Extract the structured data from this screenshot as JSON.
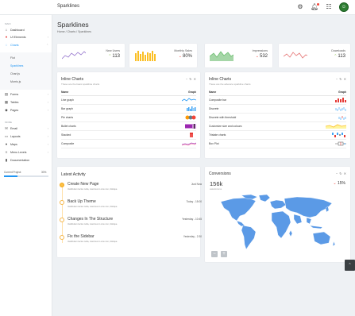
{
  "app": {
    "title": "Sparklines"
  },
  "topbar": {
    "settings_icon": "gear-icon",
    "notifications_icon": "bell-icon",
    "apps_icon": "grid-icon",
    "avatar_icon": "android-icon"
  },
  "sidebar": {
    "section_main": "MAIN",
    "items": [
      {
        "label": "Dashboard",
        "icon": "home-icon"
      },
      {
        "label": "UI Elements",
        "icon": "palette-icon"
      },
      {
        "label": "Charts",
        "icon": "chart-donut-icon"
      }
    ],
    "charts_sub": [
      "Flot",
      "Sparklines",
      "Chart.js",
      "Morris.js"
    ],
    "items2": [
      {
        "label": "Forms",
        "icon": "forms-icon"
      },
      {
        "label": "Tables",
        "icon": "table-icon"
      },
      {
        "label": "Pages",
        "icon": "diamond-icon"
      }
    ],
    "section_more": "MORE",
    "items3": [
      {
        "label": "Email",
        "icon": "email-icon"
      },
      {
        "label": "Layouts",
        "icon": "layouts-icon"
      },
      {
        "label": "Maps",
        "icon": "map-marker-icon"
      },
      {
        "label": "Menu Levels",
        "icon": "menu-icon"
      },
      {
        "label": "Documentation",
        "icon": "book-icon"
      }
    ],
    "project_label": "Current Project",
    "project_pct": "30%",
    "project_value": 30
  },
  "header": {
    "title": "Sparklines",
    "breadcrumb": "Home / Charts / Sparklines"
  },
  "stats": [
    {
      "label": "New Users",
      "value": "113",
      "direction": "up",
      "color": "#9575cd"
    },
    {
      "label": "Monthly Sales",
      "value": "80%",
      "direction": "down",
      "color": "#fbbf24"
    },
    {
      "label": "Impressions",
      "value": "532",
      "direction": "down",
      "color": "#66bb6a"
    },
    {
      "label": "Downloads",
      "value": "113",
      "direction": "up",
      "color": "#e57373"
    }
  ],
  "inline_charts_1": {
    "title": "Inline Charts",
    "subtitle": "These are the basic sparkline charts",
    "col_name": "Name",
    "col_graph": "Graph",
    "rows": [
      "Line graph",
      "Bar graph",
      "Pie charts",
      "Bullet charts",
      "Stacked",
      "Composite"
    ]
  },
  "inline_charts_2": {
    "title": "Inline Charts",
    "subtitle": "These are the advance sparkline charts",
    "col_name": "Name",
    "col_graph": "Graph",
    "rows": [
      "Composite bar",
      "Discrete",
      "Discrete with threshold",
      "Customize size and colours",
      "Tristate charts",
      "Box Plot"
    ]
  },
  "activity": {
    "title": "Latest Activity",
    "items": [
      {
        "title": "Create New Page",
        "desc": "Vestibulum lectus nulla, maximus in eros non, tristique.",
        "time": "Just Now"
      },
      {
        "title": "Back Up Theme",
        "desc": "Vestibulum lectus nulla, maximus in eros non, tristique.",
        "time": "Today - 15:00"
      },
      {
        "title": "Changes In The Structure",
        "desc": "Vestibulum lectus nulla, maximus in eros non, tristique.",
        "time": "Yesterday - 10:45"
      },
      {
        "title": "Fix the Sidebar",
        "desc": "Vestibulum lectus nulla, maximus in eros non, tristique.",
        "time": "Yesterday - 2:30"
      }
    ]
  },
  "conversions": {
    "title": "Conversions",
    "value": "156k",
    "sub": "sales/income",
    "pct": "15%",
    "zoom_out": "−",
    "zoom_in": "+"
  },
  "colors": {
    "accent": "#2196f3",
    "map": "#5b9ae6",
    "timeline": "#f5b547"
  }
}
